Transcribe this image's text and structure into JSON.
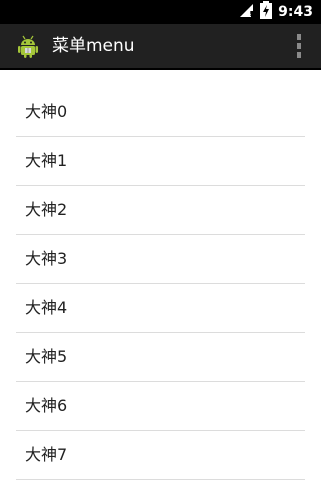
{
  "status_bar": {
    "time": "9:43",
    "icons": [
      "signal-icon",
      "battery-charging-icon"
    ]
  },
  "action_bar": {
    "title": "菜单menu",
    "app_icon": "android-icon",
    "overflow_icon": "overflow-menu-icon"
  },
  "list": {
    "items": [
      {
        "label": "大神0"
      },
      {
        "label": "大神1"
      },
      {
        "label": "大神2"
      },
      {
        "label": "大神3"
      },
      {
        "label": "大神4"
      },
      {
        "label": "大神5"
      },
      {
        "label": "大神6"
      },
      {
        "label": "大神7"
      }
    ]
  },
  "colors": {
    "status_bar_bg": "#000000",
    "action_bar_bg": "#212121",
    "text": "#222222",
    "divider": "#dcdcdc",
    "android_green": "#a4c639"
  }
}
